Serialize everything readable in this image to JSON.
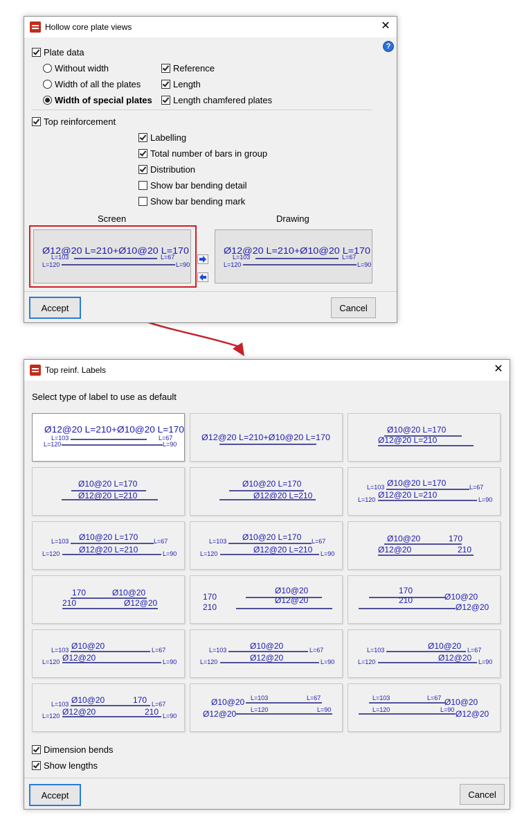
{
  "dialog1": {
    "title": "Hollow core plate views",
    "plate_data": "Plate data",
    "without_width": "Without width",
    "width_all": "Width of all the plates",
    "width_special": "Width of special plates",
    "reference": "Reference",
    "length": "Length",
    "length_chamfered": "Length chamfered plates",
    "top_reinforcement": "Top reinforcement",
    "labelling": "Labelling",
    "total_bars": "Total number of bars in group",
    "distribution": "Distribution",
    "show_bending_detail": "Show bar bending detail",
    "show_bending_mark": "Show bar bending mark",
    "screen_caption": "Screen",
    "drawing_caption": "Drawing",
    "accept": "Accept",
    "cancel": "Cancel",
    "preview_main": "Ø12@20 L=210+Ø10@20 L=170",
    "preview_l103": "L=103",
    "preview_l67": "L=67",
    "preview_l120": "L=120",
    "preview_l90": "L=90"
  },
  "dialog2": {
    "title": "Top reinf. Labels",
    "instruction": "Select type of label to use as default",
    "dimension_bends": "Dimension bends",
    "show_lengths": "Show lengths",
    "accept": "Accept",
    "cancel": "Cancel"
  },
  "icons": {
    "close": "close-icon",
    "help": "help-icon",
    "app": "app-icon",
    "arrow_right": "arrow-right-icon",
    "arrow_left": "arrow-left-icon"
  },
  "colors": {
    "label_text": "#1a1ab0",
    "label_line": "#1a1a7a",
    "highlight_frame": "#d41c24",
    "connector": "#c8202b",
    "default_button": "#2a7bd8"
  },
  "label_options": [
    {
      "texts": [
        "Ø12@20 L=210+Ø10@20 L=170",
        "L=103",
        "L=67",
        "L=120",
        "L=90"
      ]
    },
    {
      "texts": [
        "Ø12@20 L=210+Ø10@20 L=170"
      ]
    },
    {
      "texts": [
        "Ø10@20 L=170",
        "Ø12@20 L=210"
      ]
    },
    {
      "texts": [
        "Ø10@20 L=170",
        "Ø12@20 L=210"
      ]
    },
    {
      "texts": [
        "Ø10@20 L=170",
        "Ø12@20 L=210"
      ]
    },
    {
      "texts": [
        "L=103",
        "Ø10@20 L=170",
        "L=67",
        "L=120",
        "Ø12@20 L=210",
        "L=90"
      ]
    },
    {
      "texts": [
        "L=103",
        "Ø10@20 L=170",
        "L=67",
        "L=120",
        "Ø12@20 L=210",
        "L=90"
      ]
    },
    {
      "texts": [
        "L=103",
        "Ø10@20 L=170",
        "L=67",
        "L=120",
        "Ø12@20 L=210",
        "L=90"
      ]
    },
    {
      "texts": [
        "Ø10@20",
        "170",
        "Ø12@20",
        "210"
      ]
    },
    {
      "texts": [
        "170",
        "Ø10@20",
        "210",
        "Ø12@20"
      ]
    },
    {
      "texts": [
        "Ø10@20",
        "170",
        "Ø12@20",
        "210"
      ]
    },
    {
      "texts": [
        "170",
        "Ø10@20",
        "210",
        "Ø12@20"
      ]
    },
    {
      "texts": [
        "L=103",
        "Ø10@20",
        "L=67",
        "L=120",
        "Ø12@20",
        "L=90"
      ]
    },
    {
      "texts": [
        "L=103",
        "Ø10@20",
        "L=67",
        "L=120",
        "Ø12@20",
        "L=90"
      ]
    },
    {
      "texts": [
        "L=103",
        "Ø10@20",
        "L=67",
        "L=120",
        "Ø12@20",
        "L=90"
      ]
    },
    {
      "texts": [
        "L=103",
        "Ø10@20",
        "170",
        "L=67",
        "L=120",
        "Ø12@20",
        "210",
        "L=90"
      ]
    },
    {
      "texts": [
        "Ø10@20",
        "L=103",
        "L=67",
        "Ø12@20",
        "L=120",
        "L=90"
      ]
    },
    {
      "texts": [
        "L=103",
        "L=67",
        "Ø10@20",
        "L=120",
        "L=90",
        "Ø12@20"
      ]
    }
  ]
}
